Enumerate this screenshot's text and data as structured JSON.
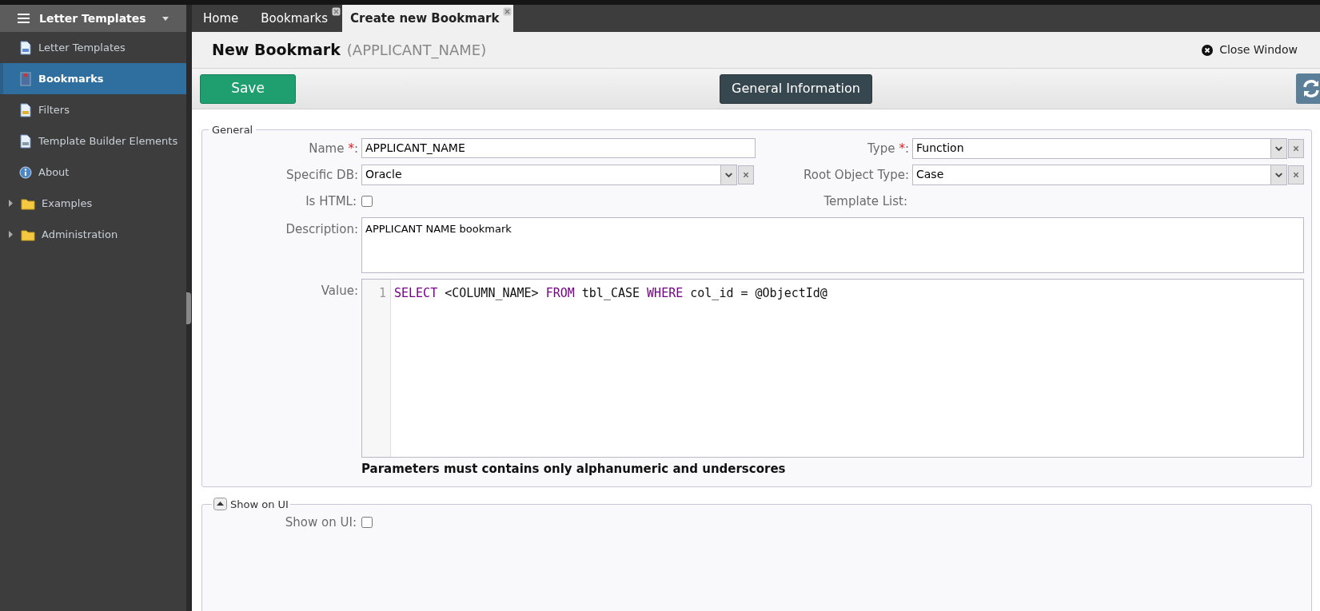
{
  "sidebar": {
    "title": "Letter Templates",
    "items": [
      {
        "label": "Letter Templates",
        "kind": "doc",
        "selected": false
      },
      {
        "label": "Bookmarks",
        "kind": "bookmark",
        "selected": true
      },
      {
        "label": "Filters",
        "kind": "filter",
        "selected": false
      },
      {
        "label": "Template Builder Elements",
        "kind": "gear",
        "selected": false
      },
      {
        "label": "About",
        "kind": "info",
        "selected": false
      },
      {
        "label": "Examples",
        "kind": "folder",
        "selected": false,
        "expanded": false
      },
      {
        "label": "Administration",
        "kind": "folder",
        "selected": false,
        "expanded": false
      }
    ]
  },
  "tabs": [
    {
      "label": "Home",
      "selected": false,
      "closable": false
    },
    {
      "label": "Bookmarks",
      "selected": false,
      "closable": true
    },
    {
      "label": "Create new Bookmark",
      "selected": true,
      "closable": true
    }
  ],
  "header": {
    "title": "New Bookmark",
    "subtitle": "(APPLICANT_NAME)",
    "close": "Close Window"
  },
  "toolbar": {
    "save": "Save",
    "section": "General Information"
  },
  "general": {
    "legend": "General",
    "name": {
      "label": "Name",
      "required": true,
      "required_mark": "*",
      "suffix": ":",
      "value": "APPLICANT_NAME"
    },
    "type": {
      "label": "Type",
      "required": true,
      "required_mark": "*",
      "suffix": ":",
      "value": "Function"
    },
    "specific_db": {
      "label": "Specific DB:",
      "value": "Oracle"
    },
    "root_object_type": {
      "label": "Root Object Type:",
      "value": "Case"
    },
    "is_html": {
      "label": "Is HTML:",
      "checked": false
    },
    "template_list": {
      "label": "Template List:"
    },
    "description": {
      "label": "Description:",
      "value": "APPLICANT NAME bookmark"
    },
    "value": {
      "label": "Value:",
      "line_number": "1",
      "tokens": [
        {
          "text": "SELECT",
          "kind": "keyword"
        },
        {
          "text": " <COLUMN_NAME> ",
          "kind": "plain"
        },
        {
          "text": "FROM",
          "kind": "keyword"
        },
        {
          "text": " tbl_CASE ",
          "kind": "plain"
        },
        {
          "text": "WHERE",
          "kind": "keyword"
        },
        {
          "text": " col_id = @ObjectId@",
          "kind": "plain"
        }
      ]
    },
    "note": "Parameters must contains only alphanumeric and underscores"
  },
  "show_on_ui": {
    "legend": "Show on UI",
    "expanded": true,
    "field": {
      "label": "Show on UI:",
      "checked": false
    }
  }
}
